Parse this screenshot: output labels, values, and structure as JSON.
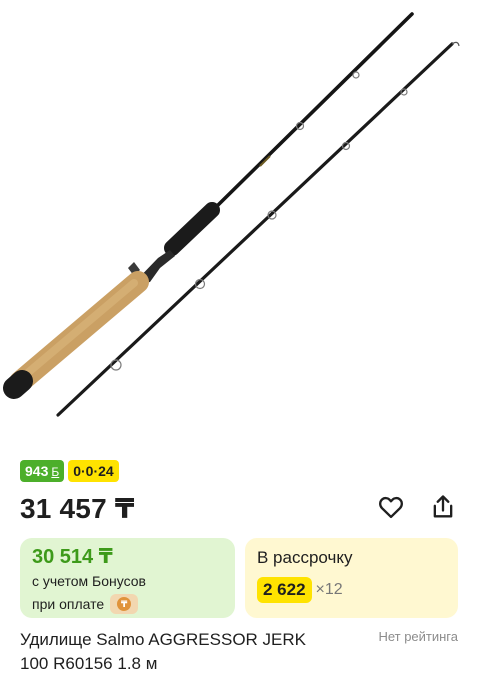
{
  "product": {
    "bonus_badge": "943",
    "bonus_badge_symbol": "Б",
    "installment_badge": "0·0·24",
    "price": "31 457 ₸",
    "title_line1": "Удилище Salmo AGGRESSOR JERK",
    "title_line2": "100 R60156 1.8 м",
    "rating_text": "Нет рейтинга"
  },
  "bonus_card": {
    "price": "30 514 ₸",
    "note_line1": "с учетом Бонусов",
    "note_line2": "при оплате"
  },
  "installment_card": {
    "title": "В рассрочку",
    "amount": "2 622",
    "multiplier": "×12"
  },
  "colors": {
    "bonus_green": "#4caf2a",
    "installment_yellow": "#ffe300",
    "bonus_card_bg": "#e1f5d2",
    "installment_card_bg": "#fff8d1"
  },
  "icons": {
    "favorite": "heart-icon",
    "share": "share-icon",
    "wallet": "wallet-icon"
  }
}
